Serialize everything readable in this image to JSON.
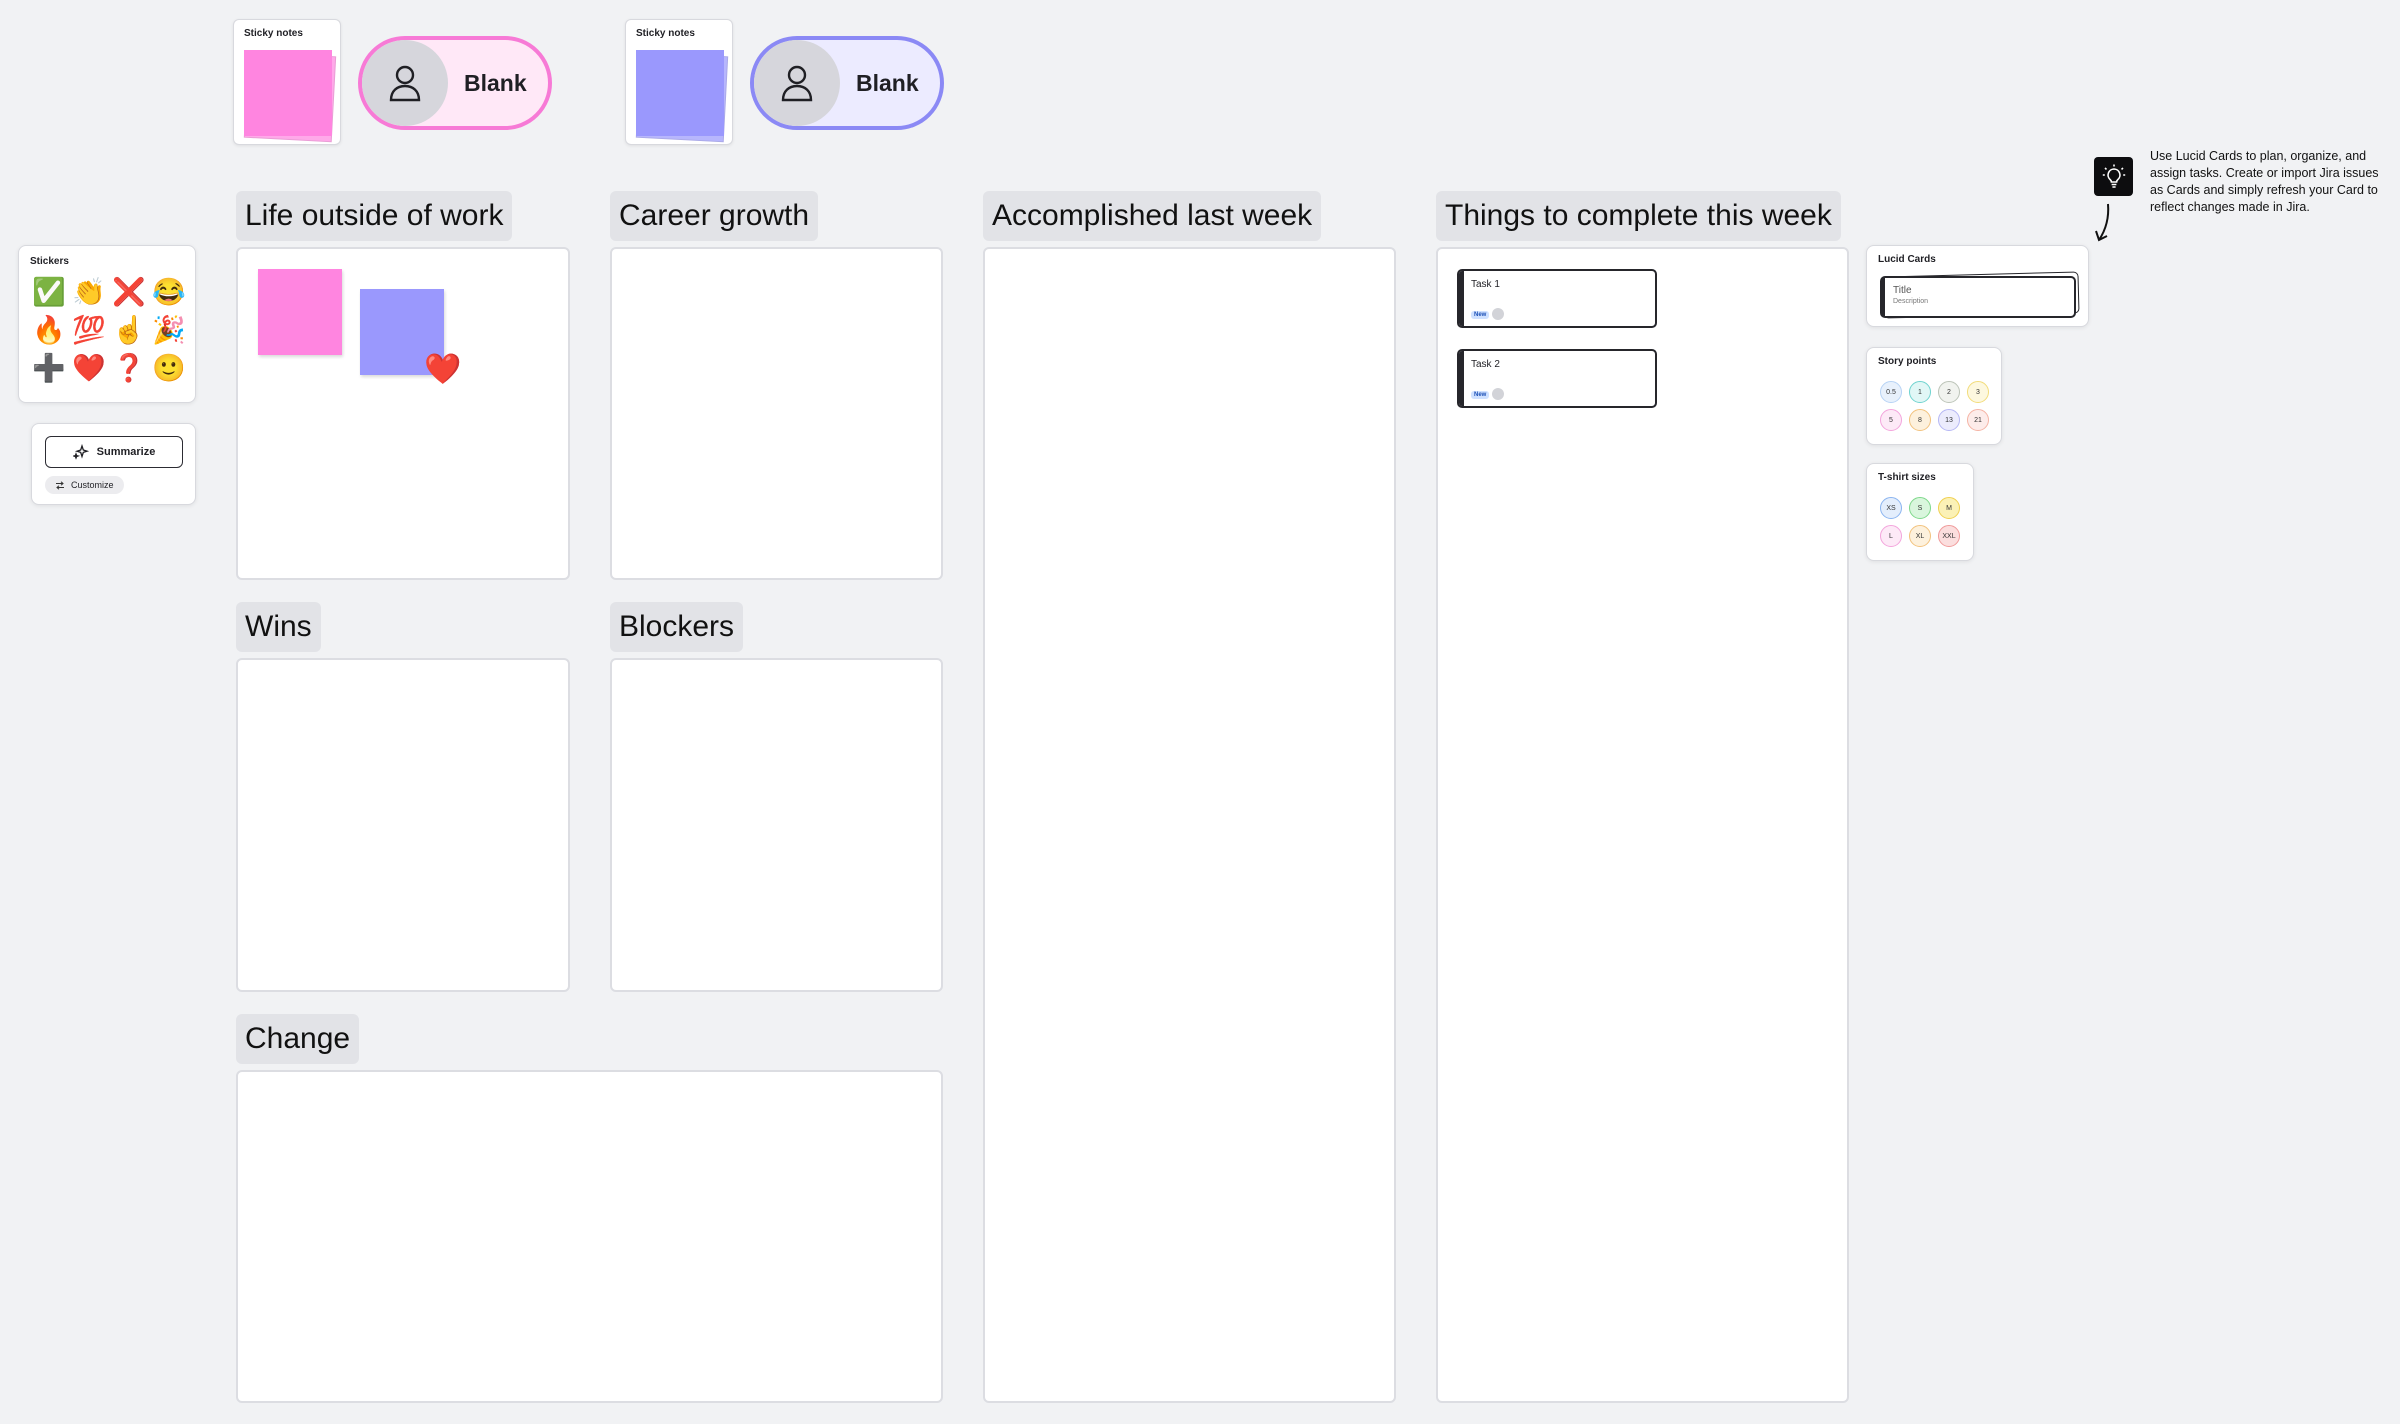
{
  "sticky_note_stacks": [
    {
      "label": "Sticky notes",
      "color": "#ff85e0",
      "blank_label": "Blank",
      "pill_border": "#f77ad6",
      "pill_bg": "#ffe8f7"
    },
    {
      "label": "Sticky notes",
      "color": "#9a98fd",
      "blank_label": "Blank",
      "pill_border": "#8b89f5",
      "pill_bg": "#ecebff"
    }
  ],
  "sections": {
    "life_outside_work": "Life outside of work",
    "career_growth": "Career growth",
    "accomplished_last_week": "Accomplished last week",
    "things_to_complete": "Things to complete this week",
    "wins": "Wins",
    "blockers": "Blockers",
    "change": "Change"
  },
  "stickers": {
    "title": "Stickers",
    "items": [
      "✅",
      "👏",
      "❌",
      "😂",
      "🔥",
      "💯",
      "☝️",
      "🎉",
      "➕",
      "❤️",
      "❓",
      "🙂"
    ]
  },
  "ai": {
    "summarize_label": "Summarize",
    "customize_label": "Customize"
  },
  "tasks": [
    {
      "title": "Task 1",
      "badge": "New"
    },
    {
      "title": "Task 2",
      "badge": "New"
    }
  ],
  "tip": {
    "text": "Use Lucid Cards to plan, organize, and assign tasks. Create or import Jira issues as Cards and simply refresh your Card to reflect changes made in Jira."
  },
  "lucid_cards": {
    "title": "Lucid Cards",
    "card_title": "Title",
    "card_description": "Description"
  },
  "story_points": {
    "title": "Story points",
    "values": [
      "0.5",
      "1",
      "2",
      "3",
      "5",
      "8",
      "13",
      "21"
    ],
    "colors": [
      [
        "#b7d3f5",
        "#e8f1fc"
      ],
      [
        "#6fd3cf",
        "#e1f7f6"
      ],
      [
        "#bcc4b8",
        "#f1f3ef"
      ],
      [
        "#f2dc7a",
        "#fdf8df"
      ],
      [
        "#f3a4dc",
        "#fdeaf7"
      ],
      [
        "#f2c27d",
        "#fdf1dd"
      ],
      [
        "#b5b7f4",
        "#ececfd"
      ],
      [
        "#f5b3a4",
        "#fdecea"
      ]
    ]
  },
  "tshirt_sizes": {
    "title": "T-shirt sizes",
    "values": [
      "XS",
      "S",
      "M",
      "L",
      "XL",
      "XXL"
    ],
    "colors": [
      [
        "#8ab4f0",
        "#e4eefc"
      ],
      [
        "#7ed88a",
        "#d9f6dd"
      ],
      [
        "#f0d050",
        "#fbf1b6"
      ],
      [
        "#f3a4dc",
        "#fdeaf7"
      ],
      [
        "#f2c27d",
        "#fdf1dd"
      ],
      [
        "#f09a9a",
        "#fbdede"
      ]
    ]
  },
  "reaction": "❤️"
}
